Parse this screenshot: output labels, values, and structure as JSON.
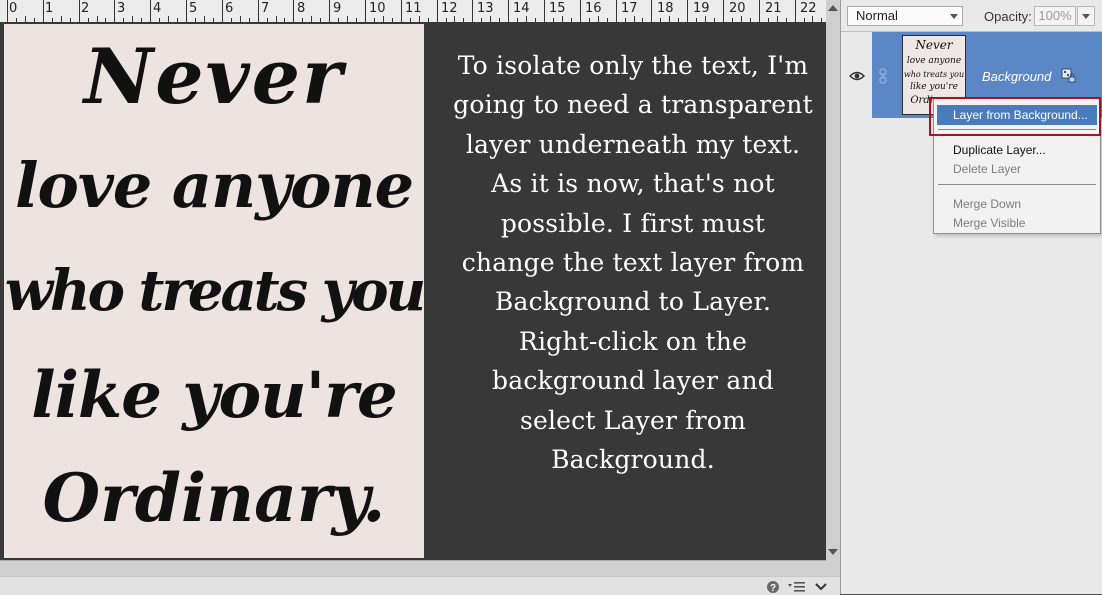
{
  "ruler": {
    "numbers": [
      "0",
      "1",
      "2",
      "3",
      "4",
      "5",
      "6",
      "7",
      "8",
      "9",
      "10",
      "11",
      "12",
      "13",
      "14",
      "15",
      "16",
      "17",
      "18",
      "19",
      "20",
      "21",
      "22"
    ]
  },
  "image_text": {
    "lines": [
      "Never",
      "love anyone",
      "who treats you",
      "like you're",
      "Ordinary."
    ]
  },
  "instruction": {
    "text": "To isolate only the text, I'm going to need a transparent layer underneath my text. As it is now, that's not possible. I first must change the text layer from Background to Layer. Right-click on the background layer and select Layer from Background."
  },
  "layers_panel": {
    "blend_mode": "Normal",
    "opacity_label": "Opacity:",
    "opacity_value": "100%",
    "layer": {
      "name": "Background",
      "thumbnail_lines": [
        "Never",
        "love anyone",
        "who treats you",
        "like you're",
        "Ordinary."
      ]
    }
  },
  "context_menu": {
    "items": [
      "Layer from Background...",
      "Duplicate Layer...",
      "Delete Layer",
      "Merge Down",
      "Merge Visible"
    ]
  },
  "colors": {
    "canvas": "#383838",
    "layer_selected": "#5b87c6",
    "menu_highlight": "#4a7bbd",
    "callout": "#b0101a"
  },
  "icons": [
    "eye-icon",
    "link-icon",
    "lock-icon",
    "help-icon",
    "panel-menu-icon",
    "chevron-down-icon"
  ]
}
